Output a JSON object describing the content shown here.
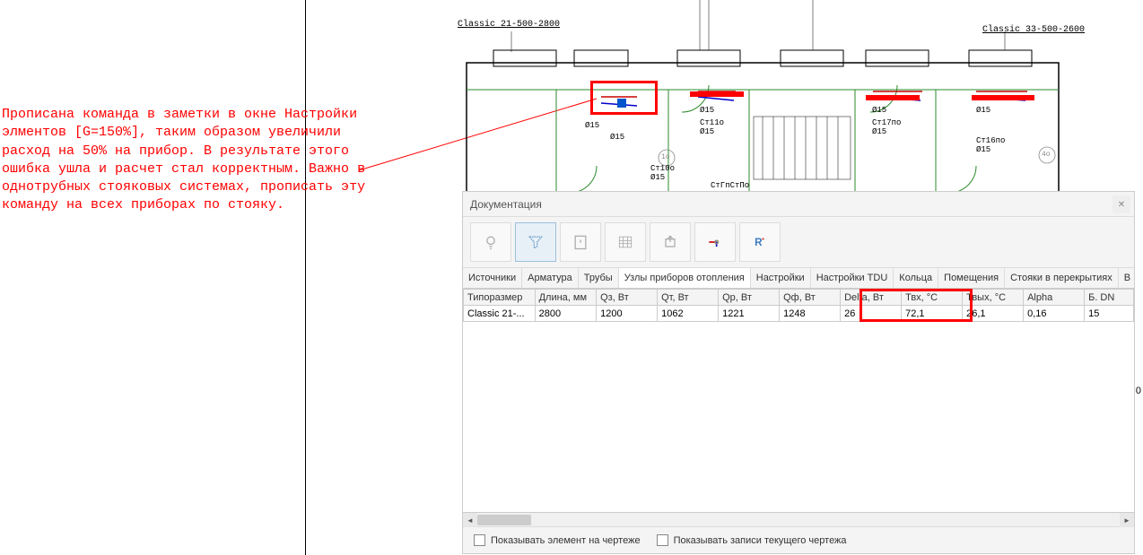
{
  "annotation": "Прописана команда в заметки в окне Настройки элментов [G=150%], таким образом увеличили расход на 50% на прибор. В результате этого ошибка ушла и расчет стал корректным. Важно в однотрубных стояковых системах, прописать эту команду на всех приборах по стояку.",
  "drawing": {
    "label1": "Classic 21-500-2800",
    "label2": "Classic 33-500-2600",
    "texts": {
      "a": "Ø15",
      "b": "Ø15",
      "c": "Ст10о",
      "c2": "Ø15",
      "d": "Ø15",
      "e": "Ст11о",
      "e2": "Ø15",
      "f": "Ø15",
      "g": "Ст17по",
      "g2": "Ø15",
      "h": "Ø15",
      "i": "Ст16по",
      "i2": "Ø15",
      "j": "СтГпСтПо",
      "circ1": "1о",
      "circ2": "4о"
    }
  },
  "panel": {
    "title": "Документация",
    "tabs": [
      "Источники",
      "Арматура",
      "Трубы",
      "Узлы приборов отопления",
      "Настройки",
      "Настройки TDU",
      "Кольца",
      "Помещения",
      "Стояки в перекрытиях",
      "В"
    ],
    "active_tab": 3,
    "columns": [
      "Типоразмер",
      "Длина, мм",
      "Qз, Вт",
      "Qт, Вт",
      "Qр, Вт",
      "Qф, Вт",
      "Delta, Вт",
      "Твх, °C",
      "Твых, °C",
      "Alpha",
      "Б. DN"
    ],
    "row": [
      "Classic 21-...",
      "2800",
      "1200",
      "1062",
      "1221",
      "1248",
      "26",
      "72,1",
      "26,1",
      "0,16",
      "15"
    ],
    "footer": {
      "chk1": "Показывать элемент на чертеже",
      "chk2": "Показывать записи текущего чертежа"
    }
  },
  "stray": "0"
}
